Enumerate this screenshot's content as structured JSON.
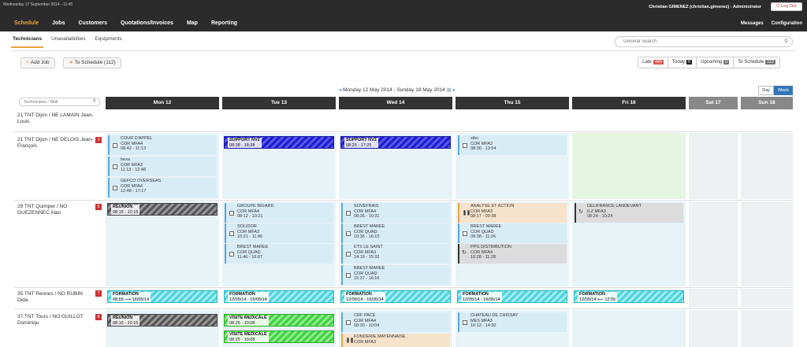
{
  "topbar": {
    "date": "Wednesday 17 September 2014 - 11:45",
    "user": "Christian GIMENEZ (christian.gimenez) - Administrator",
    "logout": "Log Out",
    "nav": [
      "Schedule",
      "Jobs",
      "Customers",
      "Quotations/Invoices",
      "Map",
      "Reporting"
    ],
    "right_nav": [
      "Messages",
      "Configuration"
    ]
  },
  "subnav": {
    "tabs": [
      "Technicians",
      "Unavailabilities",
      "Equipments"
    ]
  },
  "search": {
    "placeholder": "General Search"
  },
  "actions": {
    "add_job": "Add Job",
    "to_schedule": "To Schedule (112)"
  },
  "counts": [
    {
      "label": "Late",
      "value": "445",
      "color": "#d9534f"
    },
    {
      "label": "Today",
      "value": "0",
      "color": "#222222"
    },
    {
      "label": "Upcoming",
      "value": "0",
      "color": "#777777"
    },
    {
      "label": "To Schedule",
      "value": "112",
      "color": "#777777"
    }
  ],
  "week": {
    "label": "Monday 12 May 2014 - Sunday 18 May 2014",
    "views": [
      "Day",
      "Week"
    ]
  },
  "grid": {
    "tech_search_placeholder": "Technicians / Skill",
    "days": [
      "Mon 12",
      "Tue 13",
      "Wed 14",
      "Thu 15",
      "Fri 16",
      "Sat 17",
      "Sun 18"
    ]
  },
  "rows": [
    {
      "label": "21 TNT Dijon / NE LAMAIN Jean-Louis",
      "badge": ""
    },
    {
      "label": "21 TNT Dijon / NE DELOIS Jean-François",
      "badge": "3"
    },
    {
      "label": "29 TNT Quimper / NO GUEZENNEC Alan",
      "badge": "5"
    },
    {
      "label": "35 TNT Rennes / NO RUBIN Dida",
      "badge": "7"
    },
    {
      "label": "37 TNT Tours / NO GUILLOT Dominiqu",
      "badge": "8"
    }
  ],
  "jobs": [
    {
      "name": "COUR D'APPEL",
      "skill": "COR MFA4",
      "time": "08:42 - 11:13"
    },
    {
      "name": "bexa",
      "skill": "COR MFA3",
      "time": "11:13 - 12:48"
    },
    {
      "name": "GEFCO OVERSEAS",
      "skill": "COR MFA4",
      "time": "12:48 - 17:17"
    },
    {
      "name": "sibo",
      "skill": "COR MFA3",
      "time": "08:36 - 13:54"
    },
    {
      "name": "GROUPE BIGARD",
      "skill": "COR MFA4",
      "time": "08:12 - 10:21"
    },
    {
      "name": "SOLIDOR",
      "skill": "COR MFA3",
      "time": "10:21 - 11:46"
    },
    {
      "name": "BREST MAREE",
      "skill": "COR QUAD",
      "time": "11:46 - 16:07"
    },
    {
      "name": "SOVEFRAIS",
      "skill": "COR MFA4",
      "time": "08:36 - 10:31"
    },
    {
      "name": "BREST MAREE",
      "skill": "COR QUAD",
      "time": "10:36 - 16:15"
    },
    {
      "name": "ETS LE SAINT",
      "skill": "COR MFA3",
      "time": "14:19 - 15:32"
    },
    {
      "name": "BREST MAREE",
      "skill": "COR QUAD",
      "time": "15:37 - 16:16"
    },
    {
      "name": "ANALYSE ET ACTION",
      "skill": "COR MFA3",
      "time": "08:17 - 09:38"
    },
    {
      "name": "BREST MAREE",
      "skill": "COR QUAD",
      "time": "09:38 - 11:26"
    },
    {
      "name": "PPG DISTRIBUTION",
      "skill": "COR MFA4",
      "time": "10:28 - 11:28"
    },
    {
      "name": "DELIFRANCE LANDEVANT",
      "skill": "ILZ MFA3",
      "time": "08:24 - 10:24"
    },
    {
      "name": "CRF PACE",
      "skill": "COR MFA4",
      "time": "08:30 - 10:04"
    },
    {
      "name": "CHATEAU DE CHISSAY",
      "skill": "MES MFA3",
      "time": "10:12 - 14:30"
    },
    {
      "name": "FONDERIE MAYENNAISE",
      "skill": "COR MFA3",
      "time": ""
    }
  ],
  "bands": [
    {
      "name": "SUPPORT NV2",
      "time": "08:38 - 18:38"
    },
    {
      "name": "SUPPORT NV2",
      "time": "08:25 - 17:25"
    },
    {
      "name": "REUNION",
      "time": "08:15 - 12:15"
    },
    {
      "name": "FORMATION",
      "time": "08:55 ⟶ 16/05/14"
    },
    {
      "name": "FORMATION",
      "time": "12/05/14 - 16/05/14"
    },
    {
      "name": "FORMATION",
      "time": "12/05/14 - 16/05/14"
    },
    {
      "name": "FORMATION",
      "time": "12/05/14 - 16/05/14"
    },
    {
      "name": "FORMATION",
      "time": "12/05/14 ⟵ 12:55"
    },
    {
      "name": "REUNION",
      "time": "08:15 - 12:15"
    },
    {
      "name": "VISITE MEDICALE",
      "time": "08:25 - 10:08"
    },
    {
      "name": "VISITE MEDICALE",
      "time": "08:25 - 10:08"
    }
  ]
}
